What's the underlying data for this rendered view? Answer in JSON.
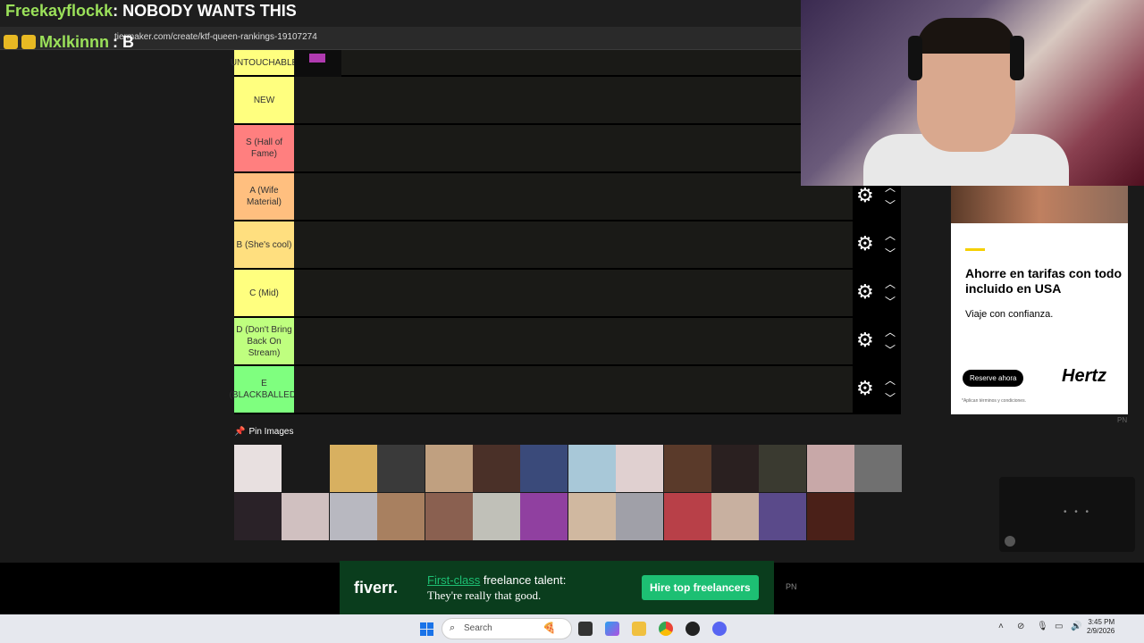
{
  "overlay": {
    "chat_user_1": "Freekayflockk",
    "chat_msg_1": ": NOBODY WANTS THIS",
    "chat_user_2": "Mxlkinnn",
    "chat_msg_2": ": B",
    "url": "tiermaker.com/create/ktf-queen-rankings-19107274"
  },
  "tiers": [
    {
      "label": "UNTOUCHABLE",
      "color": "#ffff7f"
    },
    {
      "label": "NEW",
      "color": "#ffff7f"
    },
    {
      "label": "S (Hall of Fame)",
      "color": "#ff7f7f"
    },
    {
      "label": "A (Wife Material)",
      "color": "#ffbf7f"
    },
    {
      "label": "B (She's cool)",
      "color": "#ffdf7f"
    },
    {
      "label": "C (Mid)",
      "color": "#ffff7f"
    },
    {
      "label": "D (Don't Bring Back On Stream)",
      "color": "#bfff7f"
    },
    {
      "label": "E (BLACKBALLED)",
      "color": "#7fff7f"
    }
  ],
  "pin_images": {
    "title": "Pin Images",
    "thumb_colors": [
      "#e8e0e0",
      "#1a1a1a",
      "#d8b060",
      "#3a3a3a",
      "#c0a080",
      "#4a3028",
      "#3a4a7a",
      "#a8c8d8",
      "#e0d0d0",
      "#5a3a2a",
      "#2a2020",
      "#3a3a30",
      "#c8a8a8",
      "#707070",
      "#2a2228",
      "#d0c0c0",
      "#b8b8c0",
      "#a88060",
      "#8a6050",
      "#c0c0b8",
      "#9040a0",
      "#d0b8a0",
      "#a0a0a8",
      "#b84048",
      "#c8b0a0",
      "#5a4a8a",
      "#4a2018"
    ]
  },
  "ad_right": {
    "headline": "Ahorre en tarifas con todo incluido en USA",
    "sub": "Viaje con confianza.",
    "cta": "Reserve ahora",
    "logo": "Hertz",
    "fine": "*Aplican términos y condiciones.",
    "pn": "PN"
  },
  "ad_bottom": {
    "logo": "fiverr.",
    "line1_highlight": "First-class",
    "line1_rest": " freelance talent:",
    "line2": "They're really that good.",
    "cta": "Hire top freelancers",
    "pn": "PN"
  },
  "video_box": {
    "dots": "• • •"
  },
  "taskbar": {
    "search_label": "Search",
    "time": "3:45 PM",
    "date": "2/9/2026"
  }
}
